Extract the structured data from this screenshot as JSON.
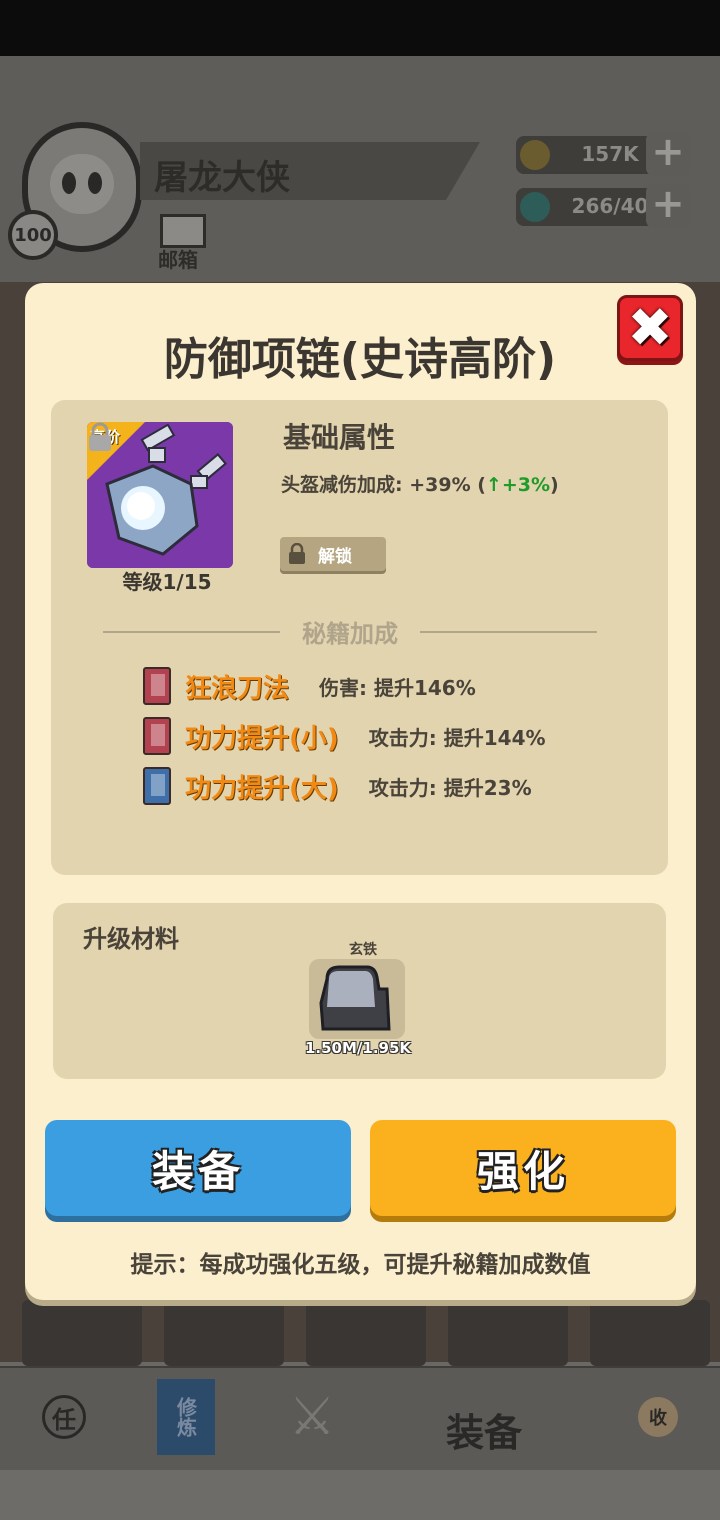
{
  "player": {
    "name": "屠龙大侠",
    "level": "100",
    "mail_label": "邮箱"
  },
  "resources": {
    "coins": "157K",
    "gems": "266/40"
  },
  "modal": {
    "title": "防御项链(史诗高阶)",
    "item": {
      "tier_label": "高阶",
      "level_text": "等级1/15"
    },
    "base_attr_title": "基础属性",
    "stat": {
      "text": "头盔减伤加成: +39% (",
      "up_arrow": "↑",
      "up_value": "+3%",
      "close_paren": ")"
    },
    "unlock_label": "解锁",
    "secret_title": "秘籍加成",
    "bonuses": [
      {
        "name": "狂浪刀法",
        "effect": "伤害: 提升146%",
        "book_color": "red"
      },
      {
        "name": "功力提升(小)",
        "effect": "攻击力: 提升144%",
        "book_color": "red"
      },
      {
        "name": "功力提升(大)",
        "effect": "攻击力: 提升23%",
        "book_color": "blue"
      }
    ],
    "materials_title": "升级材料",
    "material": {
      "name": "玄铁",
      "count": "1.50M/1.95K"
    },
    "equip_label": "装备",
    "upgrade_label": "强化",
    "tip": "提示：每成功强化五级，可提升秘籍加成数值"
  },
  "bottom_nav": {
    "active_label": "装备",
    "item1": "任",
    "item2": "修炼",
    "item5": "收"
  },
  "colors": {
    "modal_bg": "#fbefce",
    "equip_blue": "#3a9ee0",
    "upgrade_orange": "#fbb11d",
    "close_red": "#e8262b",
    "bonus_orange": "#f18a14",
    "stat_up_green": "#1f9b2a"
  }
}
